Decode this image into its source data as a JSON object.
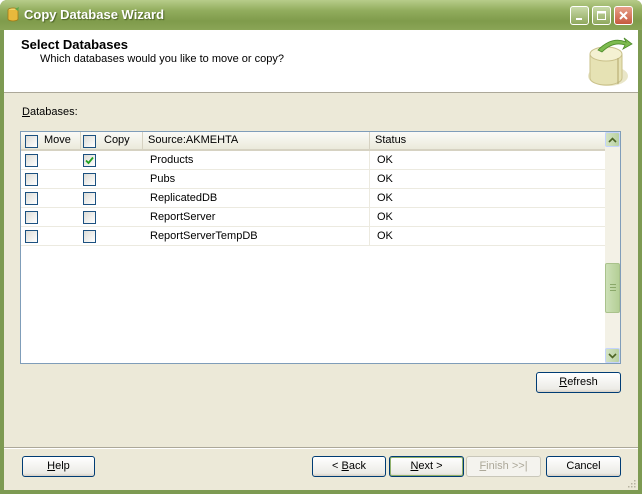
{
  "window": {
    "title": "Copy Database Wizard",
    "controls": [
      "minimize-icon",
      "maximize-icon",
      "close-icon"
    ],
    "accent_color": "#7f9b4b"
  },
  "header": {
    "title": "Select Databases",
    "subtitle": "Which databases would you like to move or copy?"
  },
  "databases_label": {
    "prefix": "D",
    "rest": "atabases:"
  },
  "grid": {
    "columns": {
      "move": "Move",
      "copy": "Copy",
      "source": "Source:AKMEHTA",
      "status": "Status"
    },
    "header_move_checked": false,
    "header_copy_checked": false,
    "rows": [
      {
        "move": false,
        "copy": true,
        "name": "Products",
        "status": "OK"
      },
      {
        "move": false,
        "copy": false,
        "name": "Pubs",
        "status": "OK"
      },
      {
        "move": false,
        "copy": false,
        "name": "ReplicatedDB",
        "status": "OK"
      },
      {
        "move": false,
        "copy": false,
        "name": "ReportServer",
        "status": "OK"
      },
      {
        "move": false,
        "copy": false,
        "name": "ReportServerTempDB",
        "status": "OK"
      }
    ]
  },
  "buttons": {
    "refresh": {
      "u": "R",
      "rest": "efresh"
    },
    "help": {
      "u": "H",
      "rest": "elp"
    },
    "back": {
      "pre": "< ",
      "u": "B",
      "rest": "ack"
    },
    "next": {
      "u": "N",
      "rest": "ext >"
    },
    "finish": {
      "u": "F",
      "rest": "inish >>|"
    },
    "cancel": "Cancel"
  }
}
